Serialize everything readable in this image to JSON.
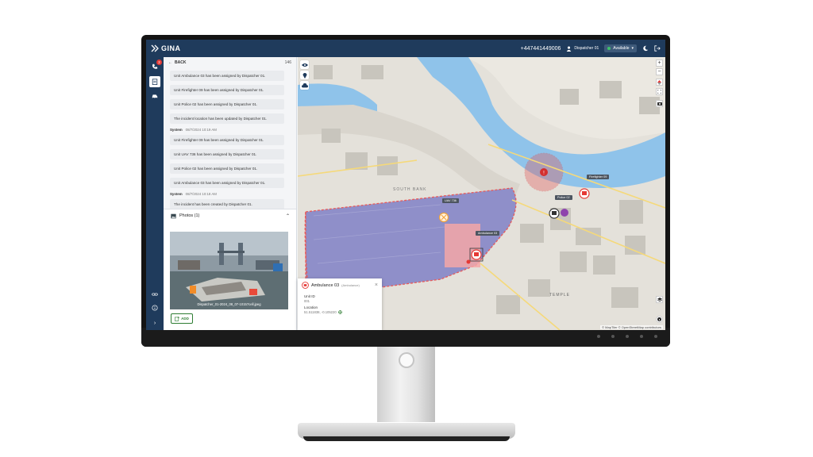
{
  "app": {
    "name": "GINA"
  },
  "topbar": {
    "phone": "+447441449006",
    "user": "Dispatcher 01",
    "status": "Available"
  },
  "rail": {
    "call_badge": "2"
  },
  "panel": {
    "back_label": "BACK",
    "count": "146",
    "messages_a": [
      "Unit Ambulance 03 has been assigned by Dispatcher 01.",
      "Unit Firefighter 09 has been assigned by Dispatcher 01.",
      "Unit Police 02 has been assigned by Dispatcher 01.",
      "The incident location has been updated by Dispatcher 01."
    ],
    "sys1": {
      "name": "System",
      "time": "08/7/2024 10:19 AM"
    },
    "messages_b": [
      "Unit Firefighter 09 has been assigned by Dispatcher 01.",
      "Unit UAV 736 has been assigned by Dispatcher 01.",
      "Unit Police 02 has been assigned by Dispatcher 01.",
      "Unit Ambulance 03 has been assigned by Dispatcher 01."
    ],
    "sys2": {
      "name": "System",
      "time": "08/7/2024 10:18 AM"
    },
    "messages_c": [
      "The incident has been created by Dispatcher 01."
    ],
    "photos": {
      "title": "Photos (1)",
      "caption": "Dispatcher_01-2024_08_07-10157cell.jpeg",
      "add_label": "ADD"
    }
  },
  "map": {
    "labels": {
      "uav": "UAV 736",
      "ambulance": "Ambulance 03",
      "police": "Police 02",
      "firefighter": "Firefighter 09"
    },
    "area": "SOUTH BANK",
    "district": "TEMPLE",
    "attribution": "© MapTiler © OpenStreetMap contributors"
  },
  "unit_card": {
    "name": "Ambulance 03",
    "type": "(Ambulance)",
    "id_label": "Unit ID",
    "id_value": "001",
    "location_label": "Location",
    "location_value": "51.511838, -0.105220"
  },
  "colors": {
    "navy": "#1f3b5c",
    "water": "#8fc3ea",
    "zone": "#8f8fc9",
    "alert": "#e53935",
    "success": "#2e7d32"
  }
}
